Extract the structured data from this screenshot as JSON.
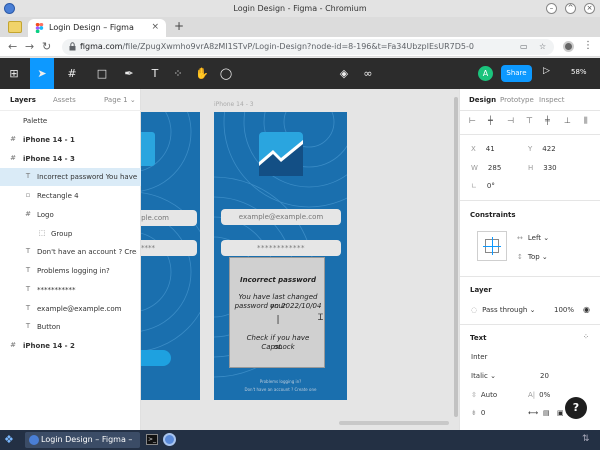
{
  "window": {
    "title": "Login Design - Figma - Chromium"
  },
  "tabs": [
    {
      "label": "Login Design – Figma",
      "close": "×"
    }
  ],
  "new_tab": "+",
  "address": {
    "host": "figma.com",
    "path": "/file/ZpugXwmho9vrA8zMI1STvP/Login-Design?node-id=8-196&t=Fa34UbzpIEsUR7D5-0"
  },
  "toolbar": {
    "avatar_initial": "A",
    "share": "Share",
    "zoom": "58%"
  },
  "layers_panel": {
    "tabs": [
      "Layers",
      "Assets"
    ],
    "page": "Page 1 ⌄",
    "items": [
      {
        "label": "Palette"
      },
      {
        "label": "iPhone 14 - 1"
      },
      {
        "label": "iPhone 14 - 3"
      },
      {
        "label": "Incorrect password You have ..."
      },
      {
        "label": "Rectangle 4"
      },
      {
        "label": "Logo"
      },
      {
        "label": "Group"
      },
      {
        "label": "Don't have an account ? Creat..."
      },
      {
        "label": "Problems logging in?"
      },
      {
        "label": "***********"
      },
      {
        "label": "example@example.com"
      },
      {
        "label": "Button"
      },
      {
        "label": "iPhone 14 - 2"
      }
    ]
  },
  "canvas": {
    "frame_label": "iPhone 14 - 3",
    "email_placeholder": "example@example.com",
    "email_partial": "mple.com",
    "password_mask": "************",
    "password_partial": "****",
    "popup": {
      "heading": "Incorrect password",
      "body1": "You have last changed your",
      "body2": "password on 2022/10/04",
      "cursor": "|",
      "hint1": "Check if you have CapsLock",
      "hint2": "on"
    },
    "problems_text": "Problems logging in?",
    "no_account_text": "Don't have an account ? Create one"
  },
  "design_panel": {
    "tabs": [
      "Design",
      "Prototype",
      "Inspect"
    ],
    "x": "41",
    "y": "422",
    "w": "285",
    "h": "330",
    "rotation": "0°",
    "constraints_title": "Constraints",
    "constraint_h": "Left",
    "constraint_v": "Top",
    "layer_title": "Layer",
    "blend": "Pass through",
    "opacity": "100%",
    "text_title": "Text",
    "font": "Inter",
    "style": "Italic",
    "size": "20",
    "line_height": "Auto",
    "letter_spacing": "0%",
    "paragraph": "0"
  },
  "taskbar": {
    "window_label": "Login Design – Figma – ..."
  },
  "colors": {
    "accent": "#0d99ff",
    "frame_blue": "#1a6fae",
    "toolbar": "#2c2c2c"
  }
}
